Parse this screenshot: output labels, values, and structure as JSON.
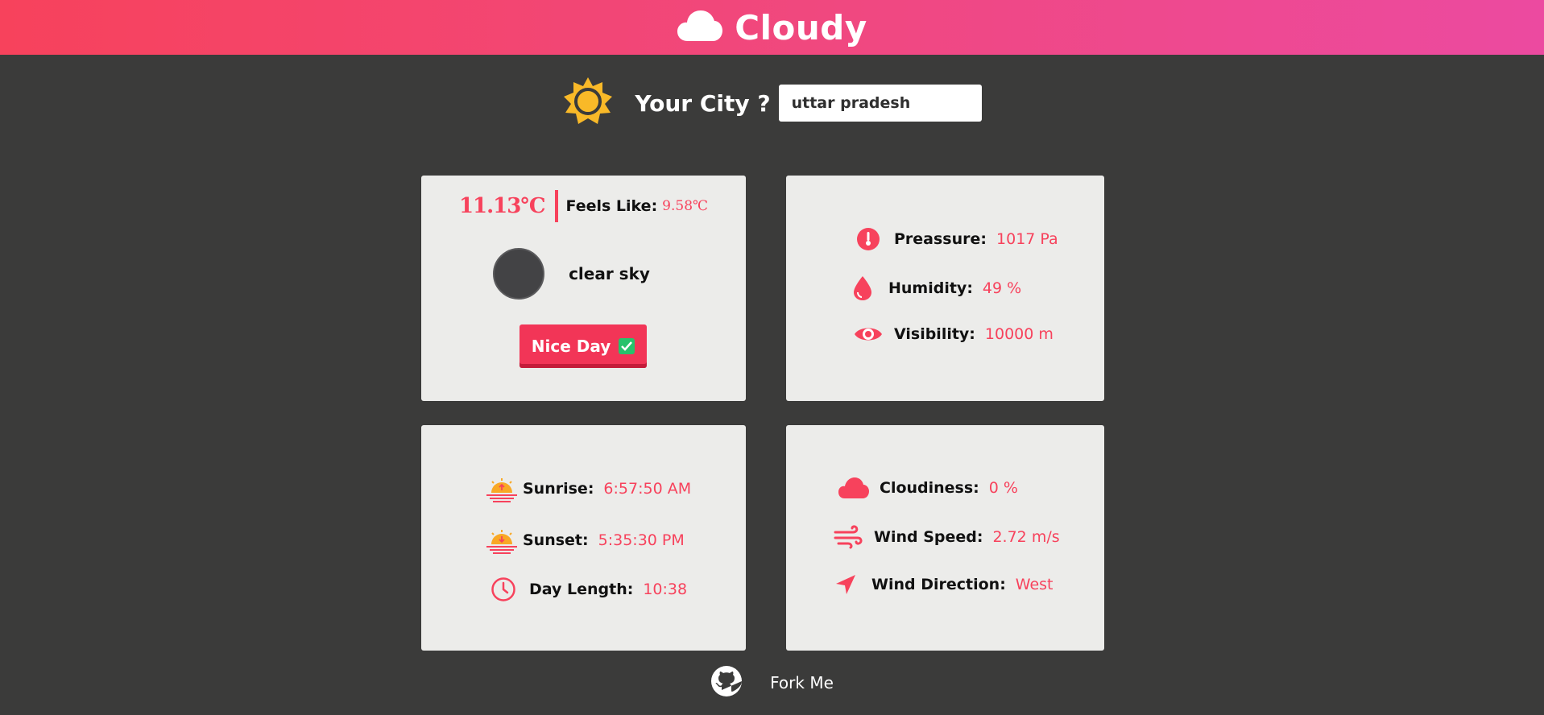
{
  "header": {
    "title": "Cloudy",
    "icon": "cloud-icon",
    "gradient": [
      "#f7425c",
      "#ec4aa0"
    ]
  },
  "search": {
    "label": "Your City ?",
    "value": "uttar pradesh",
    "icon": "sun-icon"
  },
  "temperature": {
    "current": "11.13℃",
    "feels_like_label": "Feels Like:",
    "feels_like_value": "9.58℃",
    "condition": "clear sky",
    "status_button": "Nice Day"
  },
  "atmosphere": [
    {
      "label": "Preassure:",
      "value": "1017 Pa",
      "icon": "thermometer-icon"
    },
    {
      "label": "Humidity:",
      "value": "49 %",
      "icon": "droplet-icon"
    },
    {
      "label": "Visibility:",
      "value": "10000 m",
      "icon": "eye-icon"
    }
  ],
  "sun": [
    {
      "label": "Sunrise:",
      "value": "6:57:50 AM",
      "icon": "sunrise-icon"
    },
    {
      "label": "Sunset:",
      "value": "5:35:30 PM",
      "icon": "sunset-icon"
    },
    {
      "label": "Day Length:",
      "value": "10:38",
      "icon": "clock-icon"
    }
  ],
  "wind": [
    {
      "label": "Cloudiness:",
      "value": "0 %",
      "icon": "cloud-icon"
    },
    {
      "label": "Wind Speed:",
      "value": "2.72 m/s",
      "icon": "wind-icon"
    },
    {
      "label": "Wind Direction:",
      "value": "West",
      "icon": "navigation-arrow-icon"
    }
  ],
  "footer": {
    "link": "Fork Me",
    "icon": "github-icon"
  },
  "colors": {
    "accent": "#f7425c",
    "background": "#3b3b3a",
    "card": "#ececea",
    "success": "#27c26b",
    "sun": "#f9b928"
  }
}
